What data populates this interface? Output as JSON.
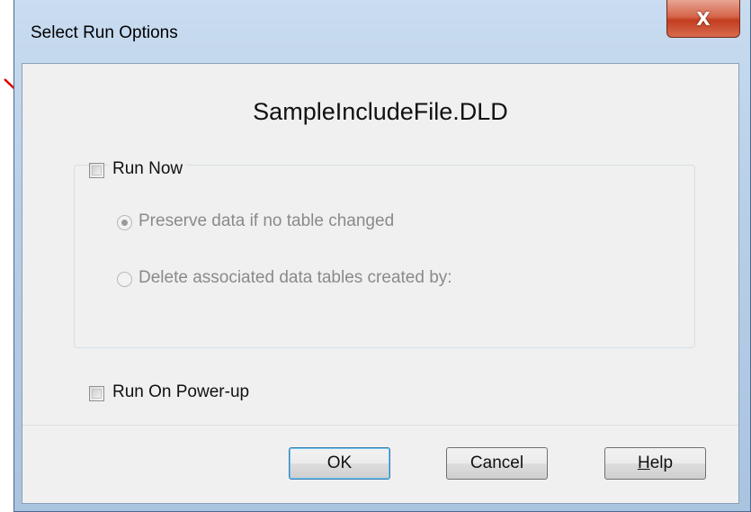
{
  "dialog": {
    "title": "Select Run Options",
    "close_glyph": "X",
    "filename": "SampleIncludeFile.DLD"
  },
  "options": {
    "run_now_label": "Run Now",
    "run_now_checked": false,
    "preserve_label": "Preserve data if no table changed",
    "preserve_selected": true,
    "delete_label": "Delete associated data tables created by:",
    "delete_selected": false,
    "run_on_powerup_label": "Run On Power-up",
    "run_on_powerup_checked": false
  },
  "buttons": {
    "ok": "OK",
    "cancel": "Cancel",
    "help_prefix": "",
    "help_mnemonic": "H",
    "help_rest": "elp"
  },
  "colors": {
    "annotation_arrow": "#e00000",
    "close_button": "#c23d1f"
  }
}
